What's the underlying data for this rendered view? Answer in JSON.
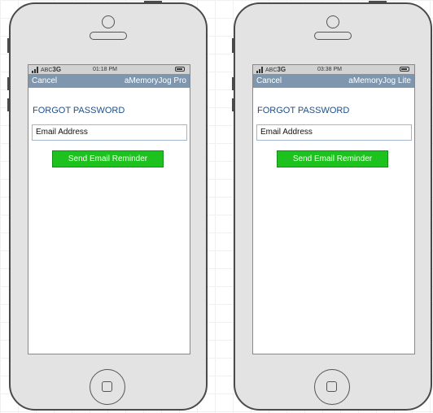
{
  "phones": [
    {
      "status": {
        "carrier": "ABC",
        "network": "3G",
        "time": "01:18 PM"
      },
      "nav": {
        "cancel_label": "Cancel",
        "title": "aMemoryJog Pro"
      },
      "heading": "FORGOT PASSWORD",
      "email_placeholder": "Email Address",
      "send_button_label": "Send Email Reminder"
    },
    {
      "status": {
        "carrier": "ABC",
        "network": "3G",
        "time": "03:38 PM"
      },
      "nav": {
        "cancel_label": "Cancel",
        "title": "aMemoryJog Lite"
      },
      "heading": "FORGOT PASSWORD",
      "email_placeholder": "Email Address",
      "send_button_label": "Send Email Reminder"
    }
  ],
  "colors": {
    "navbar": "#7f97ae",
    "heading": "#1f4e8a",
    "send_button": "#1ec21e",
    "phone_body": "#e3e3e3"
  },
  "icons": [
    "signal-icon",
    "battery-icon",
    "speaker-icon",
    "home-button-icon"
  ]
}
